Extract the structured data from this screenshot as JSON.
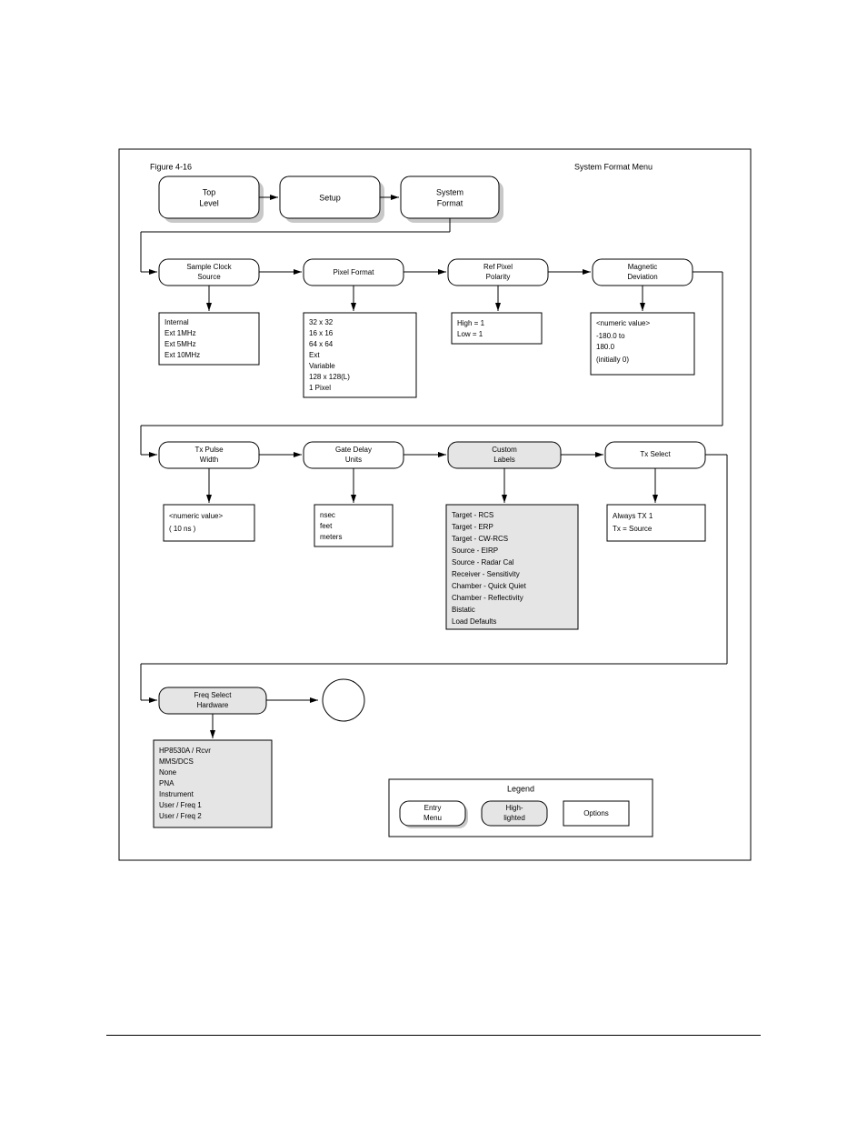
{
  "figure_label_left": "Figure 4-16",
  "figure_label_right": "System Format Menu",
  "top_path": [
    {
      "label": "Top\nLevel"
    },
    {
      "label": "Setup"
    },
    {
      "label": "System\nFormat"
    }
  ],
  "row1": [
    {
      "node": "Sample Clock\nSource",
      "options": [
        "Internal",
        "Ext 1MHz",
        "Ext 5MHz",
        "Ext 10MHz"
      ]
    },
    {
      "node": "Pixel Format",
      "options": [
        "32 x 32",
        "16 x 16",
        "64 x 64",
        "Ext",
        "Variable",
        "128 x 128(L)",
        "1 Pixel"
      ]
    },
    {
      "node": "Ref Pixel\nPolarity",
      "options": [
        "High = 1",
        "Low = 1"
      ]
    },
    {
      "node": "Magnetic\nDeviation",
      "options": [
        "<numeric value>",
        "-180.0 to",
        "180.0",
        "(initially 0)"
      ]
    }
  ],
  "row2": [
    {
      "node": "Tx Pulse\nWidth",
      "options": [
        "<numeric value>",
        "( 10 ns )"
      ]
    },
    {
      "node": "Gate Delay\nUnits",
      "options": [
        "nsec",
        "feet",
        "meters"
      ]
    },
    {
      "node": "Custom\nLabels",
      "options": [
        "Target - RCS",
        "Target - ERP",
        "Target - CW-RCS",
        "Source - EIRP",
        "Source - Radar Cal",
        "Receiver - Sensitivity",
        "Chamber - Quick Quiet",
        "Chamber - Reflectivity",
        "Bistatic",
        "Load Defaults"
      ]
    },
    {
      "node": "Tx Select",
      "options": [
        "Always TX 1",
        "Tx = Source"
      ]
    }
  ],
  "row3": {
    "node": "Freq Select\nHardware",
    "options": [
      "HP8530A / Rcvr",
      "MMS/DCS",
      "None",
      "PNA",
      "Instrument",
      "User / Freq 1",
      "User / Freq 2"
    ]
  },
  "legend": {
    "title": "Legend",
    "entry": "Entry\nMenu",
    "highlighted": "High-\nlighted",
    "options": "Options"
  }
}
